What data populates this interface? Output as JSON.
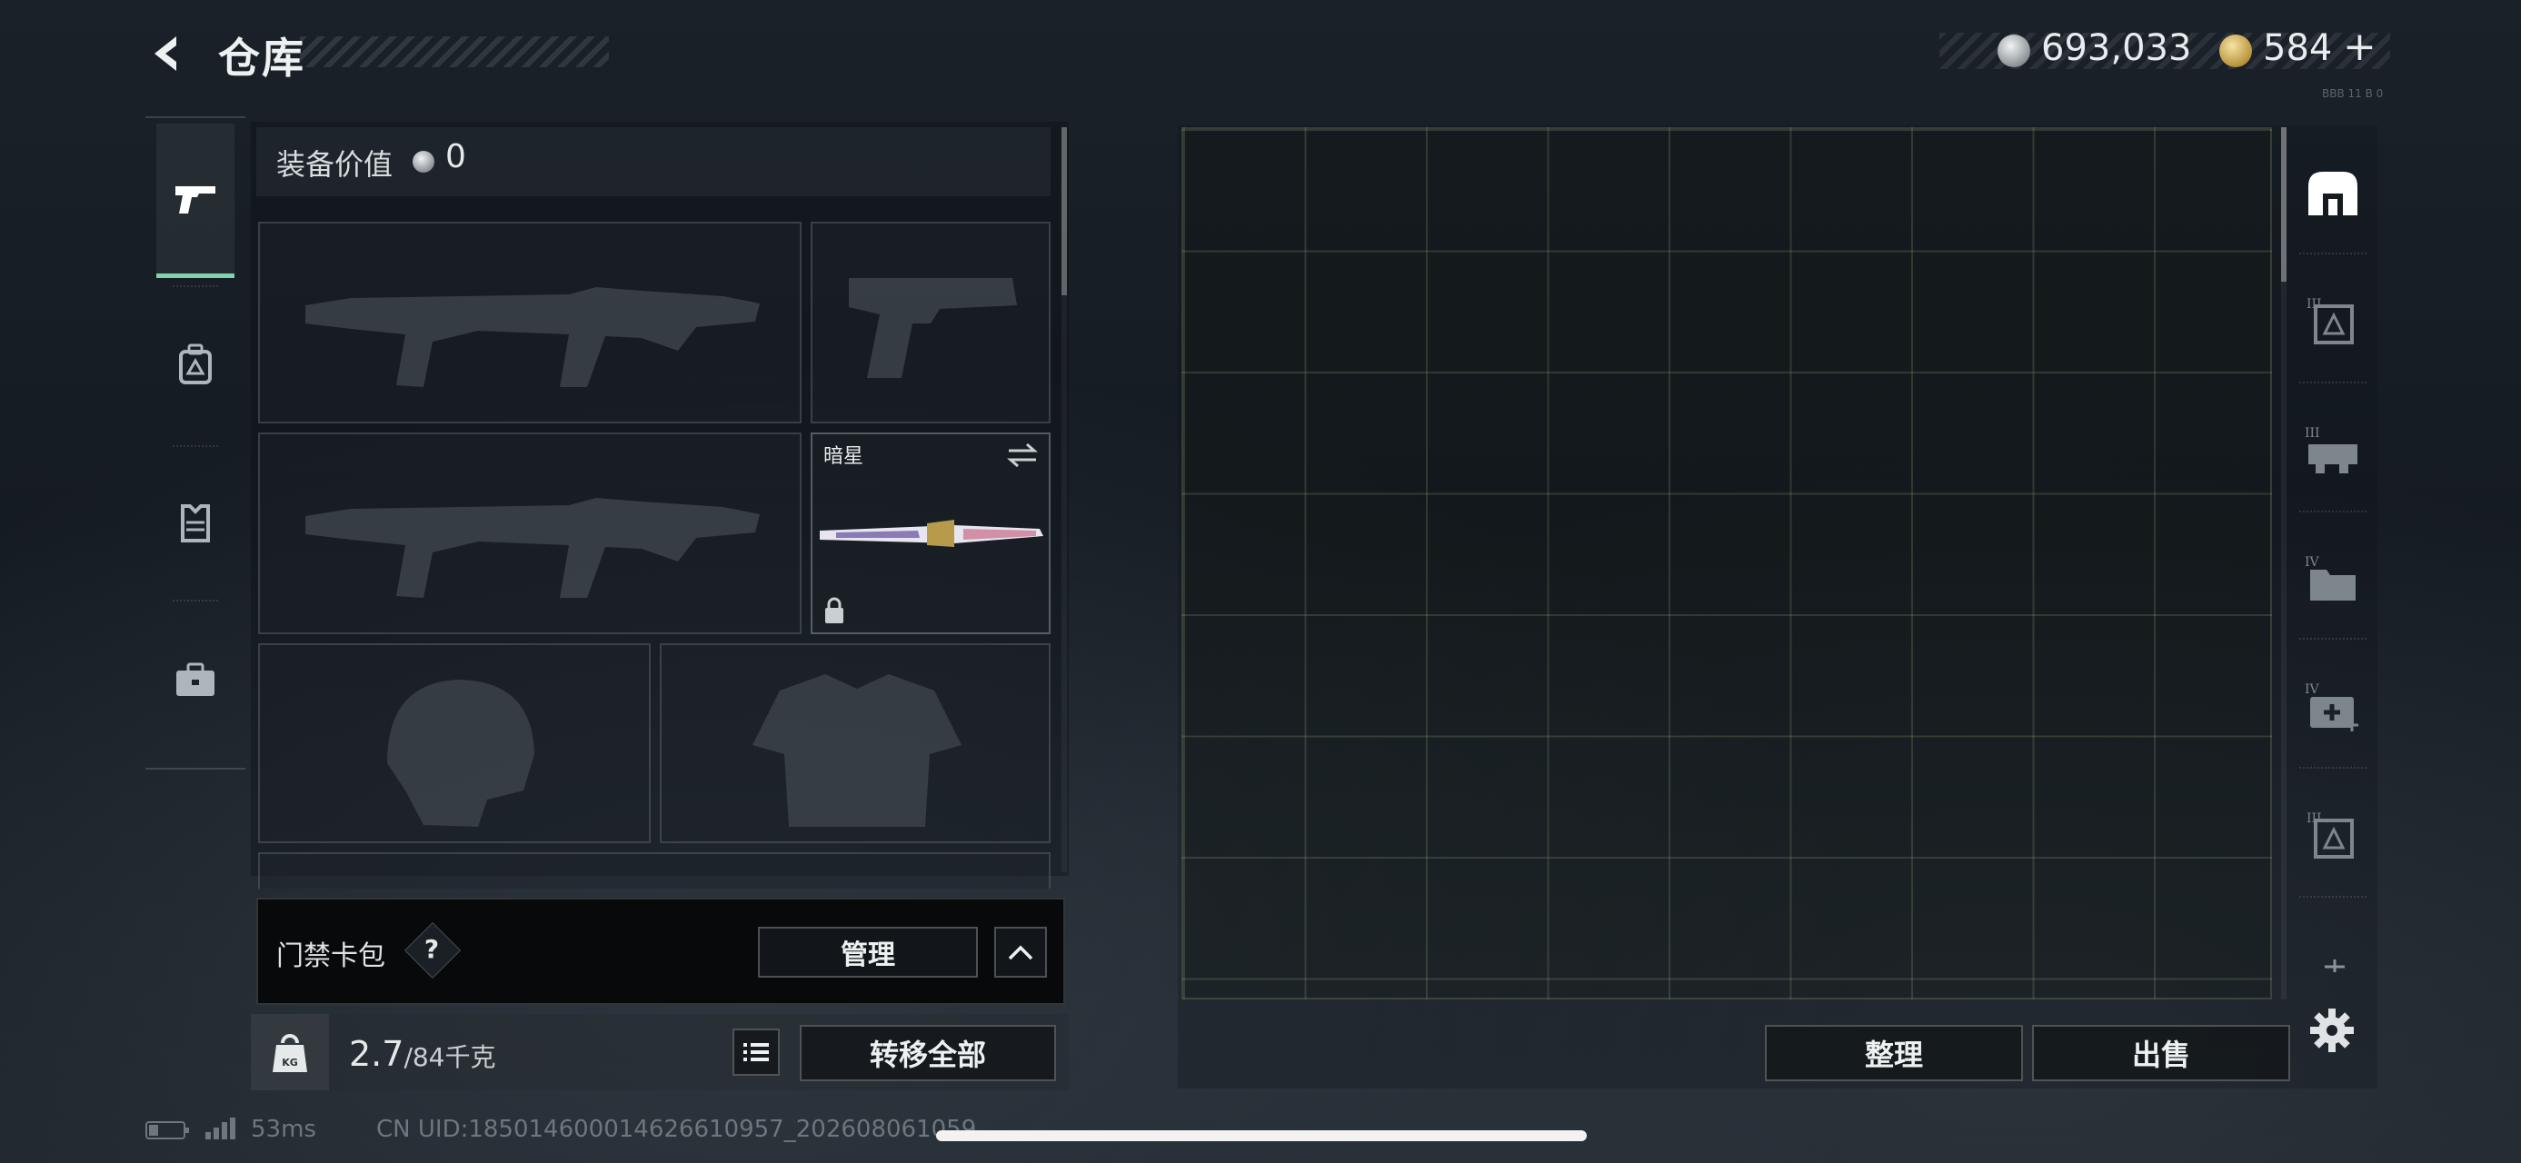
{
  "header": {
    "title": "仓库",
    "silver_amount": "693,033",
    "gold_amount": "584",
    "gold_add": "+",
    "build_note": "BBB 11 B 0"
  },
  "equipment": {
    "value_label": "装备价值",
    "value": "0",
    "knife_name": "暗星"
  },
  "card_bag": {
    "label": "门禁卡包",
    "help": "?",
    "manage_label": "管理"
  },
  "weight": {
    "current": "2.7",
    "max": "/84千克",
    "icon_text": "KG",
    "transfer_all_label": "转移全部"
  },
  "storage": {
    "tidy_label": "整理",
    "sell_label": "出售"
  },
  "status_bar": {
    "ping": "53ms",
    "uid": "CN UID:185014600014626610957_202608061059"
  },
  "colors": {
    "accent": "#7fd4ae",
    "background": "#151b22"
  },
  "icons": {
    "left_tabs": [
      "pistol-icon",
      "backpack-icon",
      "vest-icon",
      "briefcase-icon"
    ],
    "right_tabs": [
      "home-icon",
      "container-icon",
      "rig-icon",
      "folder-icon",
      "medkit-icon",
      "case-icon",
      "plus-icon"
    ]
  }
}
